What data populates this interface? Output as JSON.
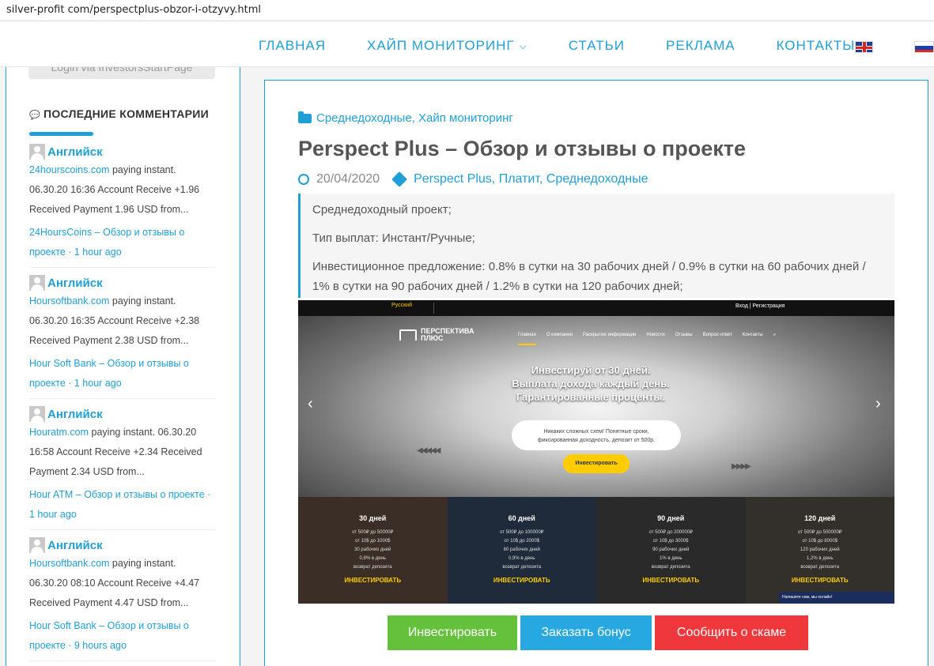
{
  "browser": {
    "url": "silver-profit com/perspectplus-obzor-i-otzyvy.html"
  },
  "nav": {
    "items": [
      "ГЛАВНАЯ",
      "ХАЙП МОНИТОРИНГ",
      "СТАТЬИ",
      "РЕКЛАМА",
      "КОНТАКТЫ"
    ],
    "languages": [
      "english-flag",
      "russian-flag"
    ]
  },
  "sidebar": {
    "login_button": "Login via InvestorsStartPage",
    "widget_title": "ПОСЛЕДНИЕ КОММЕНТАРИИ",
    "comments": [
      {
        "author": "Английск",
        "site": "24hourscoins.com",
        "text": "paying instant. 06.30.20 16:36 Account Receive +1.96 Received Payment 1.96 USD from...",
        "post": "24HoursCoins – Обзор и отзывы о проекте · 1 hour ago"
      },
      {
        "author": "Английск",
        "site": "Hoursoftbank.com",
        "text": "paying instant. 06.30.20 16:35 Account Receive +2.38 Received Payment 2.38 USD from...",
        "post": "Hour Soft Bank – Обзор и отзывы о проекте · 1 hour ago"
      },
      {
        "author": "Английск",
        "site": "Houratm.com",
        "text": "paying instant. 06.30.20 16:58 Account Receive +2.34 Received Payment 2.34 USD from...",
        "post": "Hour ATM – Обзор и отзывы о проекте · 1 hour ago"
      },
      {
        "author": "Английск",
        "site": "Hoursoftbank.com",
        "text": "paying instant. 06.30.20 08:10 Account Receive +4.47 Received Payment 4.47 USD from...",
        "post": "Hour Soft Bank – Обзор и отзывы о проекте · 9 hours ago"
      }
    ]
  },
  "article": {
    "categories": [
      "Среднедоходные,",
      "Хайп мониторинг"
    ],
    "title": "Perspect Plus – Обзор и отзывы о проекте",
    "date": "20/04/2020",
    "tags": [
      "Perspect Plus,",
      "Платит,",
      "Среднедоходные"
    ],
    "quote": [
      "Среднедоходный проект;",
      "Тип выплат: Инстант/Ручные;",
      "Инвестиционное предложение: 0.8% в сутки на 30 рабочих дней / 0.9% в сутки на 60 рабочих дней / 1% в сутки на 90 рабочих дней / 1.2% в сутки на 120 рабочих дней;"
    ]
  },
  "screenshot": {
    "lang": "Русский",
    "login": "Вход | Регистрация",
    "brand": [
      "ПЕРСПЕКТИВА",
      "ПЛЮС"
    ],
    "menu": [
      "Главная",
      "О компании",
      "Раскрытие информации",
      "Новости",
      "Отзывы",
      "Вопрос-ответ",
      "Контакты"
    ],
    "headline": [
      "Инвестируй от 30 дней.",
      "Выплата дохода каждый день.",
      "Гарантированные проценты."
    ],
    "bubble": [
      "Никаких сложных схем! Понятные сроки,",
      "фиксированная доходность, депозит от 500р."
    ],
    "cta": "Инвестировать",
    "plans": [
      {
        "title": "30 дней",
        "lines": [
          "от 500₽ до 50000₽",
          "от 10$ до 1000$",
          "30 рабочих дней",
          "0,8% в день",
          "возврат депозита"
        ],
        "cta": "ИНВЕСТИРОВАТЬ"
      },
      {
        "title": "60 дней",
        "lines": [
          "от 500₽ до 100000₽",
          "от 10$ до 2000$",
          "60 рабочих дней",
          "0,9% в день",
          "возврат депозита"
        ],
        "cta": "ИНВЕСТИРОВАТЬ"
      },
      {
        "title": "90 дней",
        "lines": [
          "от 500₽ до 200000₽",
          "от 10$ до 3000$",
          "90 рабочих дней",
          "1% в день",
          "возврат депозита"
        ],
        "cta": "ИНВЕСТИРОВАТЬ"
      },
      {
        "title": "120 дней",
        "lines": [
          "от 500₽ до 500000₽",
          "от 10$ до 8000$",
          "120 рабочих дней",
          "1,2% в день",
          "возврат депозита"
        ],
        "cta": "ИНВЕСТИРОВАТЬ"
      }
    ],
    "chat": "Напишите нам, мы онлайн!"
  },
  "buttons": {
    "invest": "Инвестировать",
    "bonus": "Заказать бонус",
    "scam": "Сообщить о скаме"
  },
  "colors": {
    "accent": "#1e9fd6",
    "green": "#65c13c",
    "blue": "#28a8e0",
    "red": "#f0383c",
    "yellow": "#ffcc00"
  }
}
